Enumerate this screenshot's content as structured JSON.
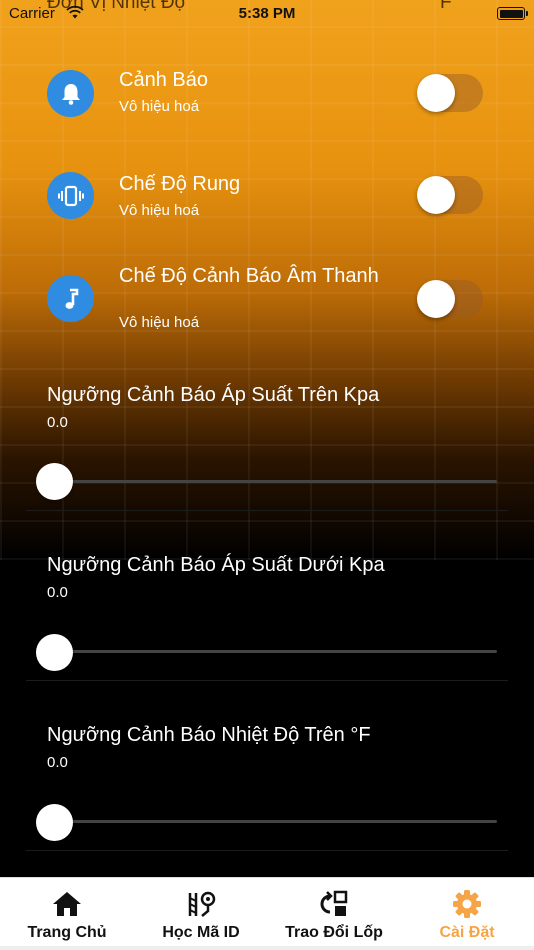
{
  "status_bar": {
    "carrier": "Carrier",
    "time": "5:38 PM"
  },
  "header_partial": {
    "left_text": "Đơn Vị Nhiệt Độ",
    "right_text": "F"
  },
  "colors": {
    "accent": "#f5a547",
    "icon_blue": "#2f8ce0",
    "background": "#000000"
  },
  "settings": [
    {
      "title": "Cảnh Báo",
      "subtitle": "Vô hiệu hoá",
      "icon": "bell-icon",
      "enabled": false
    },
    {
      "title": "Chế Độ Rung",
      "subtitle": "Vô hiệu hoá",
      "icon": "vibrate-icon",
      "enabled": false
    },
    {
      "title": "Chế Độ Cảnh Báo Âm Thanh",
      "subtitle": "Vô hiệu hoá",
      "icon": "music-note-icon",
      "enabled": false
    }
  ],
  "thresholds": [
    {
      "title": "Ngưỡng Cảnh Báo Áp Suất Trên Kpa",
      "value": "0.0",
      "slider_fraction": 0
    },
    {
      "title": "Ngưỡng Cảnh Báo Áp Suất Dưới Kpa",
      "value": "0.0",
      "slider_fraction": 0
    },
    {
      "title": "Ngưỡng Cảnh Báo Nhiệt Độ Trên °F",
      "value": "0.0",
      "slider_fraction": 0
    }
  ],
  "tabs": [
    {
      "label": "Trang Chủ",
      "icon": "home-icon",
      "active": false
    },
    {
      "label": "Học Mã ID",
      "icon": "learn-id-icon",
      "active": false
    },
    {
      "label": "Trao Đổi Lốp",
      "icon": "tire-swap-icon",
      "active": false
    },
    {
      "label": "Cài Đặt",
      "icon": "gear-icon",
      "active": true
    }
  ]
}
